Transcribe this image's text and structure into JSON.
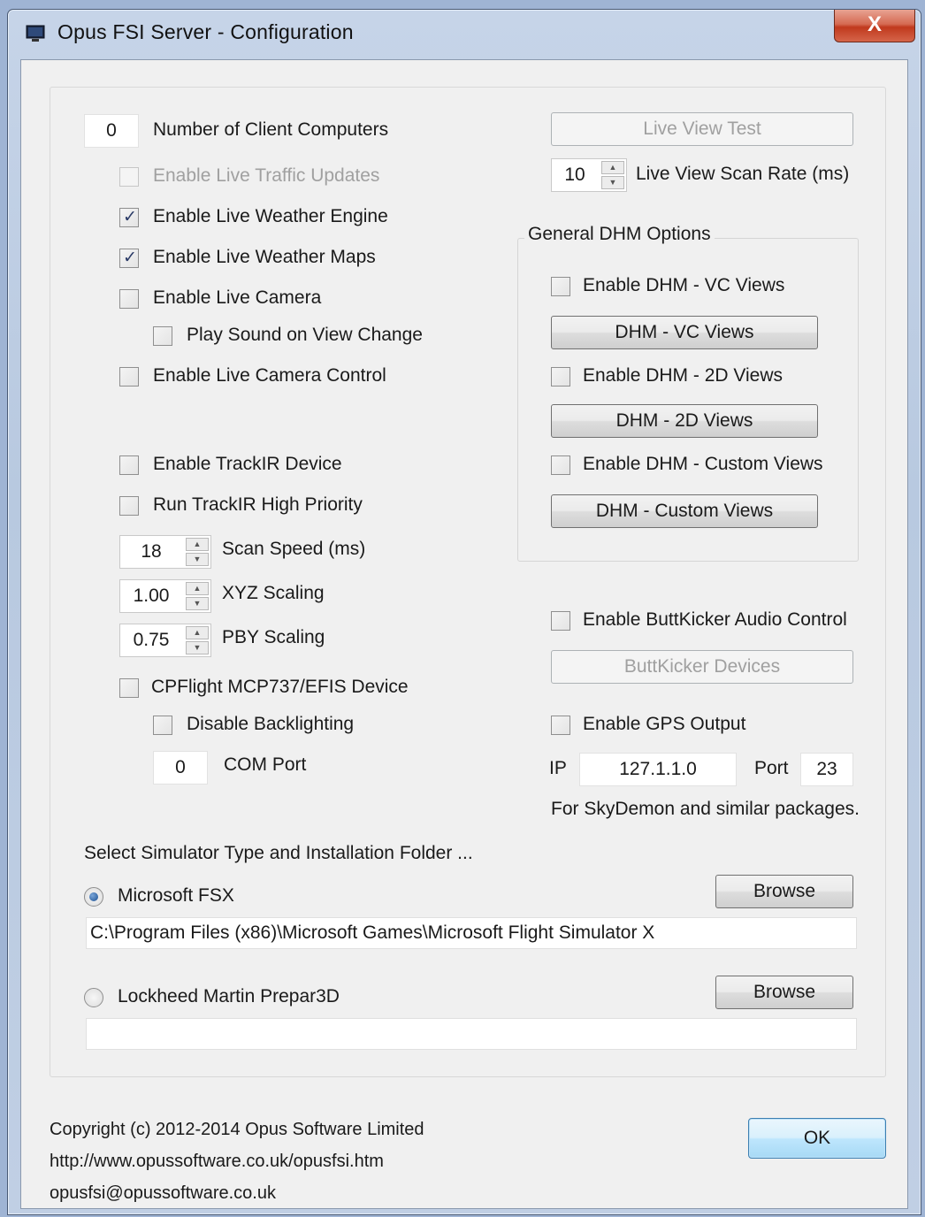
{
  "window": {
    "title": "Opus FSI Server - Configuration",
    "close_label": "X"
  },
  "left": {
    "num_clients_value": "0",
    "num_clients_label": "Number of Client Computers",
    "live_traffic_label": "Enable Live Traffic Updates",
    "live_traffic_checked": false,
    "weather_engine_label": "Enable Live Weather Engine",
    "weather_engine_checked": true,
    "weather_maps_label": "Enable Live Weather Maps",
    "weather_maps_checked": true,
    "live_camera_label": "Enable Live Camera",
    "play_sound_label": "Play Sound on View Change",
    "camera_control_label": "Enable Live Camera Control",
    "trackir_label": "Enable TrackIR Device",
    "trackir_priority_label": "Run TrackIR High Priority",
    "scan_speed_value": "18",
    "scan_speed_label": "Scan Speed (ms)",
    "xyz_value": "1.00",
    "xyz_label": "XYZ Scaling",
    "pby_value": "0.75",
    "pby_label": "PBY Scaling",
    "cpflight_label": "CPFlight MCP737/EFIS Device",
    "backlighting_label": "Disable Backlighting",
    "com_port_value": "0",
    "com_port_label": "COM Port"
  },
  "right": {
    "live_view_test_label": "Live View Test",
    "scan_rate_value": "10",
    "scan_rate_label": "Live View Scan Rate (ms)",
    "dhm_group_title": "General DHM Options",
    "dhm_vc_check_label": "Enable DHM - VC Views",
    "dhm_vc_button": "DHM - VC Views",
    "dhm_2d_check_label": "Enable DHM - 2D Views",
    "dhm_2d_button": "DHM - 2D Views",
    "dhm_custom_check_label": "Enable DHM - Custom Views",
    "dhm_custom_button": "DHM - Custom Views",
    "buttkicker_label": "Enable ButtKicker Audio Control",
    "buttkicker_button": "ButtKicker Devices",
    "gps_label": "Enable GPS Output",
    "ip_label": "IP",
    "ip_value": "127.1.1.0",
    "port_label": "Port",
    "port_value": "23",
    "gps_note": "For SkyDemon and similar packages."
  },
  "simulator": {
    "heading": "Select Simulator Type and Installation Folder ...",
    "fsx_label": "Microsoft FSX",
    "fsx_selected": true,
    "fsx_browse": "Browse",
    "fsx_path": "C:\\Program Files (x86)\\Microsoft Games\\Microsoft Flight Simulator X",
    "p3d_label": "Lockheed Martin Prepar3D",
    "p3d_browse": "Browse",
    "p3d_path": ""
  },
  "footer": {
    "copyright": "Copyright (c)  2012-2014 Opus Software Limited",
    "url": "http://www.opussoftware.co.uk/opusfsi.htm",
    "email": "opusfsi@opussoftware.co.uk",
    "ok_label": "OK"
  }
}
